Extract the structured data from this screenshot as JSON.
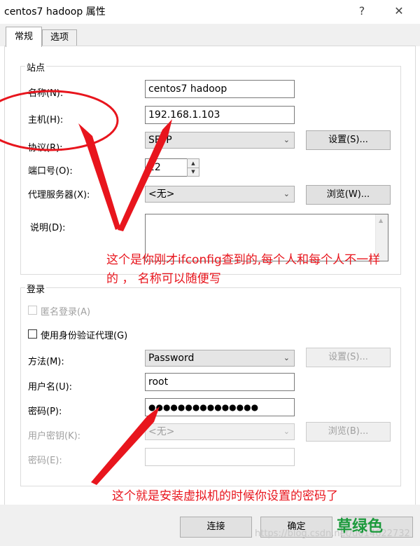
{
  "window": {
    "title": "centos7 hadoop 属性",
    "help_glyph": "?",
    "close_glyph": "✕"
  },
  "tabs": [
    {
      "label": "常规",
      "active": true
    },
    {
      "label": "选项",
      "active": false
    }
  ],
  "site": {
    "group_title": "站点",
    "name_label": "名称(N):",
    "name_value": "centos7 hadoop",
    "host_label": "主机(H):",
    "host_value": "192.168.1.103",
    "protocol_label": "协议(R):",
    "protocol_value": "SFTP",
    "settings_button": "设置(S)...",
    "port_label": "端口号(O):",
    "port_value": "22",
    "proxy_label": "代理服务器(X):",
    "proxy_value": "<无>",
    "browse_button": "浏览(W)...",
    "description_label": "说明(D):"
  },
  "login": {
    "group_title": "登录",
    "anonymous_label": "匿名登录(A)",
    "agent_label": "使用身份验证代理(G)",
    "method_label": "方法(M):",
    "method_value": "Password",
    "method_settings_button": "设置(S)...",
    "username_label": "用户名(U):",
    "username_value": "root",
    "password_label": "密码(P):",
    "password_value": "●●●●●●●●●●●●●●●",
    "user_key_label": "用户密钥(K):",
    "user_key_value": "<无>",
    "user_key_browse_button": "浏览(B)...",
    "passphrase_label": "密码(E):"
  },
  "footer": {
    "connect_button": "连接",
    "ok_button": "确定"
  },
  "annotations": {
    "note1_line1": "这个是你刚才ifconfig查到的,每个人和每个人不一样",
    "note1_line2": "的 ， 名称可以随便写",
    "note2": "这个就是安装虚拟机的时候你设置的密码了"
  },
  "watermark": {
    "text": "https://blog.csdn.net/u014622732",
    "logo_text": "草绿色"
  },
  "colors": {
    "annotation": "#e8151d",
    "logo": "#1c9a3c"
  }
}
